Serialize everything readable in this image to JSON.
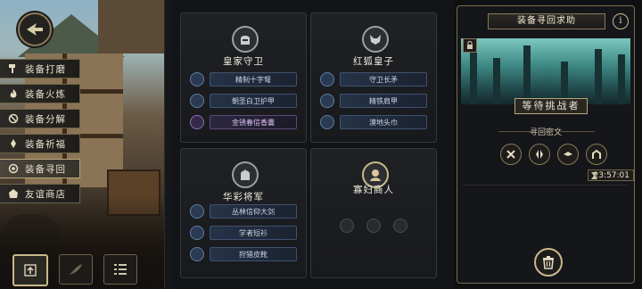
{
  "menu": {
    "items": [
      {
        "label": "装备打磨",
        "icon": "hammer-icon",
        "active": false
      },
      {
        "label": "装备火炼",
        "icon": "flame-icon",
        "active": false
      },
      {
        "label": "装备分解",
        "icon": "disassemble-icon",
        "active": false
      },
      {
        "label": "装备祈福",
        "icon": "pray-icon",
        "active": false
      },
      {
        "label": "装备寻回",
        "icon": "retrieve-icon",
        "active": true
      },
      {
        "label": "友谊商店",
        "icon": "shop-icon",
        "active": false
      }
    ]
  },
  "bottom_buttons": [
    {
      "icon": "upload-icon"
    },
    {
      "icon": "feather-icon"
    },
    {
      "icon": "list-icon"
    }
  ],
  "cards": [
    {
      "title": "皇家守卫",
      "portrait": "knight-helmet-icon",
      "items": [
        {
          "label": "精制十字弩",
          "rarity": "blue"
        },
        {
          "label": "朝圣白卫护甲",
          "rarity": "blue"
        },
        {
          "label": "金锈春信香囊",
          "rarity": "purple"
        }
      ]
    },
    {
      "title": "红狐皇子",
      "portrait": "fox-prince-icon",
      "items": [
        {
          "label": "守卫长矛",
          "rarity": "blue"
        },
        {
          "label": "精铁肩甲",
          "rarity": "blue"
        },
        {
          "label": "漠地头巾",
          "rarity": "blue"
        }
      ]
    },
    {
      "title": "华彩将军",
      "portrait": "general-helmet-icon",
      "items": [
        {
          "label": "丛林信仰大剑",
          "rarity": "blue"
        },
        {
          "label": "学者短衫",
          "rarity": "blue"
        },
        {
          "label": "狩猎皮靴",
          "rarity": "blue"
        }
      ]
    },
    {
      "title": "寡妇商人",
      "portrait": "merchant-portrait-icon",
      "items": []
    }
  ],
  "panel": {
    "title": "装备寻回求助",
    "info": "i",
    "status": "等待挑战者",
    "runes_label": "寻回密文",
    "runes": [
      "rune-x-icon",
      "rune-split-icon",
      "rune-bird-icon",
      "rune-arch-icon"
    ],
    "timer": "23:57:01"
  },
  "colors": {
    "accent_gold": "#c9b98c",
    "item_blue": "#3d5273",
    "item_purple": "#5d4a7a"
  }
}
